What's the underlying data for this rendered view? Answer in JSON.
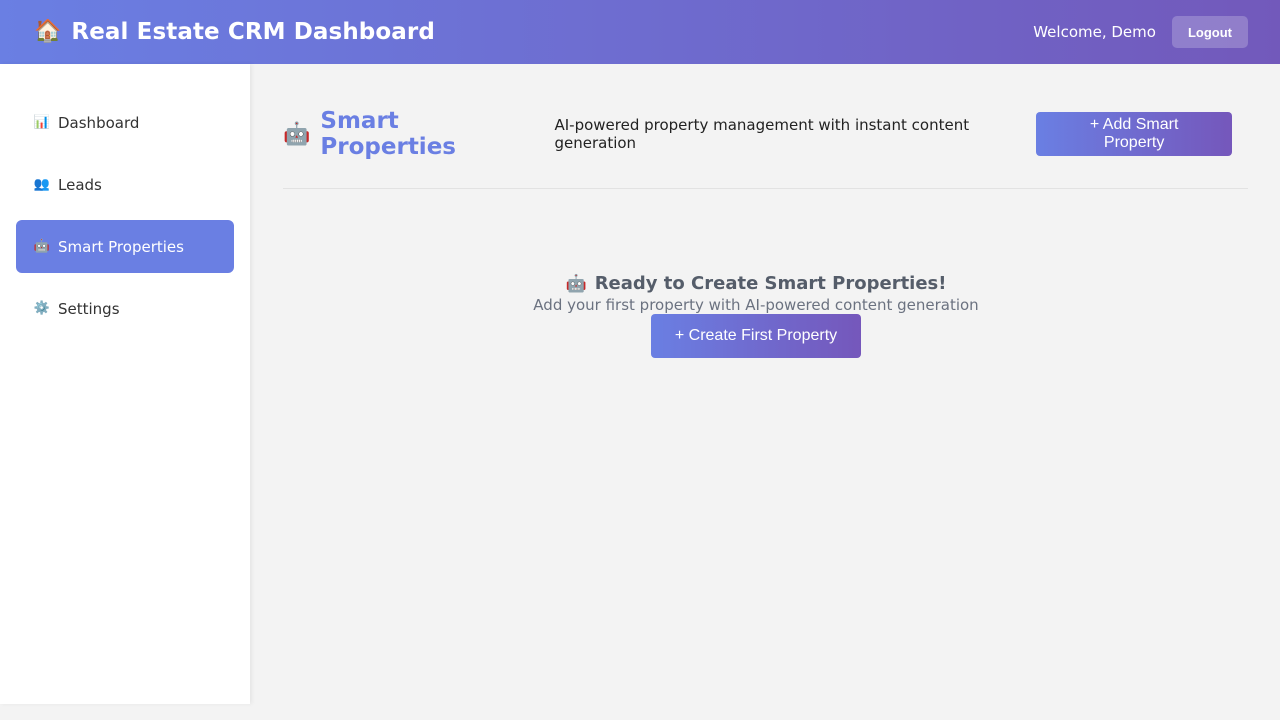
{
  "header": {
    "icon": "house-icon",
    "icon_glyph": "🏠",
    "title": "Real Estate CRM Dashboard",
    "welcome": "Welcome, Demo",
    "logout_label": "Logout"
  },
  "sidebar": {
    "items": [
      {
        "label": "Dashboard",
        "icon": "bar-chart-icon",
        "glyph": "📊",
        "active": false
      },
      {
        "label": "Leads",
        "icon": "people-icon",
        "glyph": "👥",
        "active": false
      },
      {
        "label": "Smart Properties",
        "icon": "robot-icon",
        "glyph": "🤖",
        "active": true
      },
      {
        "label": "Settings",
        "icon": "gear-icon",
        "glyph": "⚙️",
        "active": false
      }
    ]
  },
  "main": {
    "title_icon": "robot-icon",
    "title_glyph": "🤖",
    "title": "Smart Properties",
    "subtitle": "AI-powered property management with instant content generation",
    "add_button_label": "+ Add Smart Property",
    "empty_state": {
      "icon": "robot-icon",
      "glyph": "🤖",
      "title": "Ready to Create Smart Properties!",
      "subtitle": "Add your first property with AI-powered content generation",
      "button_label": "+ Create First Property"
    }
  },
  "colors": {
    "accent": "#6a7fe3",
    "accent_dark": "#7259bb",
    "background": "#f3f3f3"
  }
}
